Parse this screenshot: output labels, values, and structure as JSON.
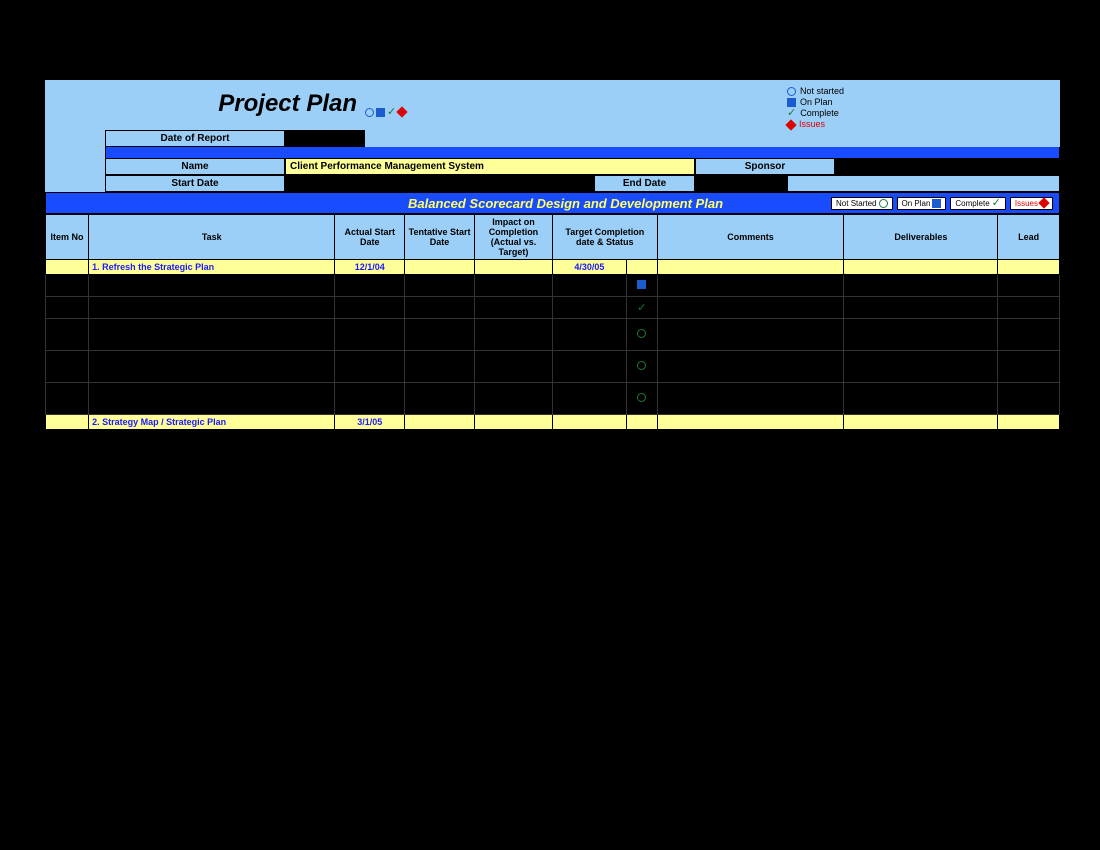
{
  "header": {
    "title": "Project Plan",
    "date_of_report_label": "Date of Report",
    "name_label": "Name",
    "name_value": "Client Performance Management System",
    "sponsor_label": "Sponsor",
    "start_label": "Start Date",
    "end_label": "End Date",
    "legend": {
      "not_started": "Not started",
      "on_plan": "On Plan",
      "complete": "Complete",
      "issues": "Issues"
    }
  },
  "section": {
    "title": "Balanced Scorecard Design and Development Plan",
    "pills": {
      "not_started": "Not Started",
      "on_plan": "On Plan",
      "complete": "Complete",
      "issues": "Issues"
    }
  },
  "columns": {
    "item_no": "Item No",
    "task": "Task",
    "actual_start": "Actual Start Date",
    "tentative_start": "Tentative Start Date",
    "impact": "Impact on Completion (Actual vs. Target)",
    "target": "Target Completion date & Status",
    "comments": "Comments",
    "deliverables": "Deliverables",
    "lead": "Lead"
  },
  "rows": [
    {
      "type": "section",
      "task": "1. Refresh the Strategic Plan",
      "actual": "12/1/04",
      "target": "4/30/05"
    },
    {
      "type": "data",
      "status": "onplan"
    },
    {
      "type": "data",
      "status": "complete"
    },
    {
      "type": "data",
      "status": "notstarted",
      "tall": true
    },
    {
      "type": "data",
      "status": "notstarted",
      "tall": true
    },
    {
      "type": "data",
      "status": "notstarted",
      "tall": true
    },
    {
      "type": "section",
      "task": "2. Strategy Map / Strategic Plan",
      "actual": "3/1/05",
      "target": ""
    }
  ]
}
